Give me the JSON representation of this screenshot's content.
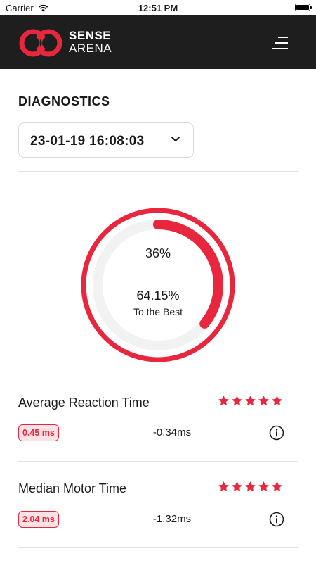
{
  "status_bar": {
    "carrier": "Carrier",
    "time": "12:51 PM"
  },
  "header": {
    "brand_line1": "SENSE",
    "brand_line2": "ARENA",
    "menu_icon": "menu-icon"
  },
  "page": {
    "title": "DIAGNOSTICS"
  },
  "session_select": {
    "selected": "23-01-19 16:08:03"
  },
  "ring": {
    "percent_text": "36%",
    "best_value": "64.15%",
    "best_label": "To the Best",
    "progress_fraction": 0.36,
    "accent": "#e8273f",
    "track": "#f2f2f2"
  },
  "metrics": [
    {
      "name": "Average Reaction Time",
      "badge": "0.45 ms",
      "delta": "-0.34ms",
      "stars": 5
    },
    {
      "name": "Median Motor Time",
      "badge": "2.04 ms",
      "delta": "-1.32ms",
      "stars": 5
    }
  ]
}
